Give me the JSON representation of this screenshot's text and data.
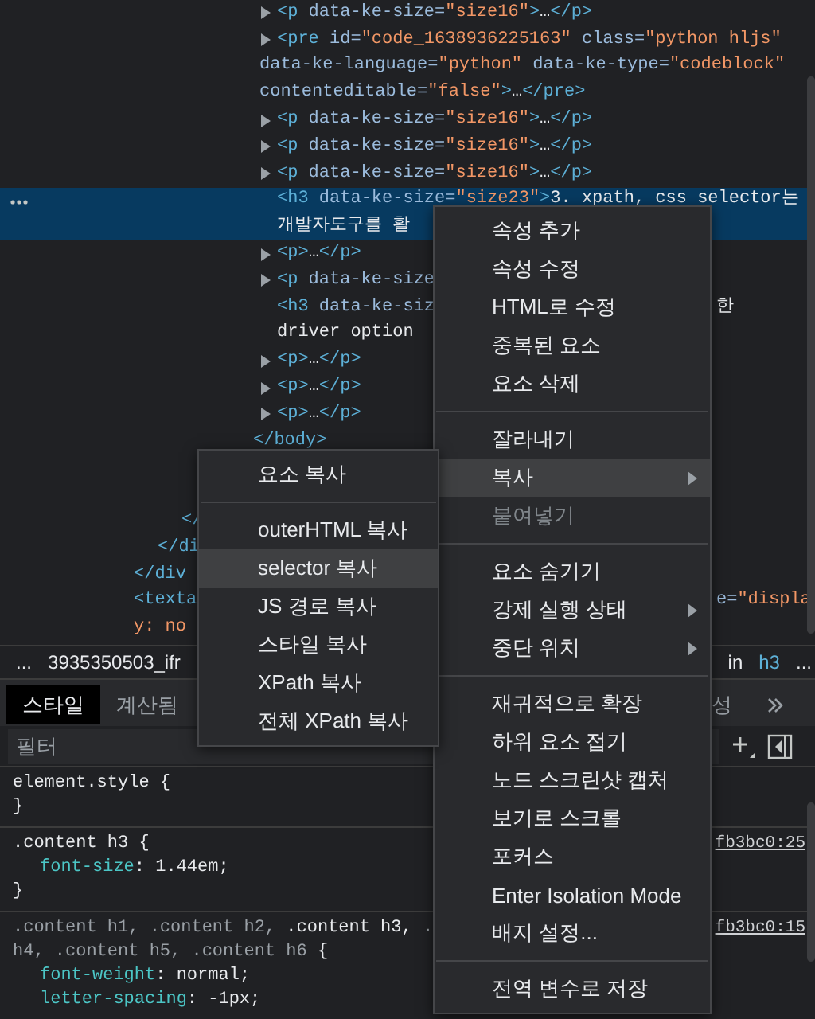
{
  "elements": {
    "nodes": [
      {
        "children": [
          {
            "children": [
              {
                "children": [
                  {
                    "children": [
                      {
                        "children": [
                          {
                            "children": [
                              {
                                "expandable": true,
                                "selected": false,
                                "line": [
                                  {
                                    "kind": "tag",
                                    "text": "<p"
                                  },
                                  {
                                    "kind": "attr",
                                    "text": " data-ke-size="
                                  },
                                  {
                                    "kind": "value",
                                    "text": "\"size16\""
                                  },
                                  {
                                    "kind": "tag",
                                    "text": ">"
                                  },
                                  {
                                    "kind": "text",
                                    "text": "…"
                                  },
                                  {
                                    "kind": "tag",
                                    "text": "</p>"
                                  }
                                ]
                              },
                              {
                                "expandable": true,
                                "selected": false,
                                "line": [
                                  {
                                    "kind": "tag",
                                    "text": "<pre"
                                  },
                                  {
                                    "kind": "attr",
                                    "text": " id="
                                  },
                                  {
                                    "kind": "value",
                                    "text": "\"code_1638936225163\""
                                  },
                                  {
                                    "kind": "attr",
                                    "text": " class="
                                  },
                                  {
                                    "kind": "value",
                                    "text": "\"python hljs\""
                                  }
                                ],
                                "continuation": [
                                  [
                                    {
                                      "kind": "attr",
                                      "text": "data-ke-language="
                                    },
                                    {
                                      "kind": "value",
                                      "text": "\"python\""
                                    },
                                    {
                                      "kind": "attr",
                                      "text": " data-ke-type="
                                    },
                                    {
                                      "kind": "value",
                                      "text": "\"codeblock\""
                                    }
                                  ],
                                  [
                                    {
                                      "kind": "attr",
                                      "text": "contenteditable="
                                    },
                                    {
                                      "kind": "value",
                                      "text": "\"false\""
                                    },
                                    {
                                      "kind": "tag",
                                      "text": ">"
                                    },
                                    {
                                      "kind": "text",
                                      "text": "…"
                                    },
                                    {
                                      "kind": "tag",
                                      "text": "</pre>"
                                    }
                                  ]
                                ]
                              },
                              {
                                "expandable": true,
                                "selected": false,
                                "line": [
                                  {
                                    "kind": "tag",
                                    "text": "<p"
                                  },
                                  {
                                    "kind": "attr",
                                    "text": " data-ke-size="
                                  },
                                  {
                                    "kind": "value",
                                    "text": "\"size16\""
                                  },
                                  {
                                    "kind": "tag",
                                    "text": ">"
                                  },
                                  {
                                    "kind": "text",
                                    "text": "…"
                                  },
                                  {
                                    "kind": "tag",
                                    "text": "</p>"
                                  }
                                ]
                              },
                              {
                                "expandable": true,
                                "selected": false,
                                "line": [
                                  {
                                    "kind": "tag",
                                    "text": "<p"
                                  },
                                  {
                                    "kind": "attr",
                                    "text": " data-ke-size="
                                  },
                                  {
                                    "kind": "value",
                                    "text": "\"size16\""
                                  },
                                  {
                                    "kind": "tag",
                                    "text": ">"
                                  },
                                  {
                                    "kind": "text",
                                    "text": "…"
                                  },
                                  {
                                    "kind": "tag",
                                    "text": "</p>"
                                  }
                                ]
                              },
                              {
                                "expandable": true,
                                "selected": false,
                                "line": [
                                  {
                                    "kind": "tag",
                                    "text": "<p"
                                  },
                                  {
                                    "kind": "attr",
                                    "text": " data-ke-size="
                                  },
                                  {
                                    "kind": "value",
                                    "text": "\"size16\""
                                  },
                                  {
                                    "kind": "tag",
                                    "text": ">"
                                  },
                                  {
                                    "kind": "text",
                                    "text": "…"
                                  },
                                  {
                                    "kind": "tag",
                                    "text": "</p>"
                                  }
                                ]
                              },
                              {
                                "expandable": false,
                                "selected": true,
                                "line": [
                                  {
                                    "kind": "tag",
                                    "text": "<h3"
                                  },
                                  {
                                    "kind": "attr",
                                    "text": " data-ke-size="
                                  },
                                  {
                                    "kind": "value",
                                    "text": "\"size23\""
                                  },
                                  {
                                    "kind": "tag",
                                    "text": ">"
                                  },
                                  {
                                    "kind": "text",
                                    "text": "3. xpath, css selector는"
                                  }
                                ],
                                "continuation": [
                                  [
                                    {
                                      "kind": "text",
                                      "text": "개발자도구를 활"
                                    }
                                  ]
                                ]
                              },
                              {
                                "expandable": true,
                                "selected": false,
                                "line": [
                                  {
                                    "kind": "tag",
                                    "text": "<p>"
                                  },
                                  {
                                    "kind": "text",
                                    "text": "…"
                                  },
                                  {
                                    "kind": "tag",
                                    "text": "</p>"
                                  }
                                ]
                              },
                              {
                                "expandable": true,
                                "selected": false,
                                "line": [
                                  {
                                    "kind": "tag",
                                    "text": "<p"
                                  },
                                  {
                                    "kind": "attr",
                                    "text": " data-ke-size"
                                  }
                                ]
                              },
                              {
                                "expandable": false,
                                "selected": false,
                                "line": [
                                  {
                                    "kind": "tag",
                                    "text": "<h3"
                                  },
                                  {
                                    "kind": "attr",
                                    "text": " data-ke-siz"
                                  }
                                ],
                                "right": [
                                  {
                                    "kind": "text",
                                    "text": "한"
                                  }
                                ],
                                "continuation": [
                                  [
                                    {
                                      "kind": "text",
                                      "text": "driver option"
                                    }
                                  ]
                                ]
                              },
                              {
                                "expandable": true,
                                "selected": false,
                                "line": [
                                  {
                                    "kind": "tag",
                                    "text": "<p>"
                                  },
                                  {
                                    "kind": "text",
                                    "text": "…"
                                  },
                                  {
                                    "kind": "tag",
                                    "text": "</p>"
                                  }
                                ]
                              },
                              {
                                "expandable": true,
                                "selected": false,
                                "line": [
                                  {
                                    "kind": "tag",
                                    "text": "<p>"
                                  },
                                  {
                                    "kind": "text",
                                    "text": "…"
                                  },
                                  {
                                    "kind": "tag",
                                    "text": "</p>"
                                  }
                                ]
                              },
                              {
                                "expandable": true,
                                "selected": false,
                                "line": [
                                  {
                                    "kind": "tag",
                                    "text": "<p>"
                                  },
                                  {
                                    "kind": "text",
                                    "text": "…"
                                  },
                                  {
                                    "kind": "tag",
                                    "text": "</p>"
                                  }
                                ]
                              }
                            ],
                            "closing": [
                              {
                                "kind": "tag",
                                "text": "</body>"
                              }
                            ]
                          }
                        ]
                      }
                    ]
                  }
                ],
                "closing": [
                  {
                    "kind": "tag",
                    "text": "</"
                  }
                ]
              }
            ],
            "closing": [
              {
                "kind": "tag",
                "text": "</di"
              }
            ]
          }
        ],
        "closing": [
          {
            "kind": "tag",
            "text": "</div"
          }
        ]
      },
      {
        "expandable": false,
        "selected": false,
        "line": [
          {
            "kind": "tag",
            "text": "<texta"
          }
        ],
        "right": [
          {
            "kind": "attr",
            "text": "e="
          },
          {
            "kind": "value",
            "text": "\"displa"
          }
        ],
        "continuation": [
          [
            {
              "kind": "value",
              "text": "y: no"
            }
          ]
        ]
      }
    ]
  },
  "breadcrumbs": {
    "left": [
      {
        "kind": "text",
        "text": "..."
      },
      {
        "kind": "text",
        "text": "3935350503_ifr"
      }
    ],
    "right": [
      {
        "kind": "text",
        "text": "in"
      },
      {
        "kind": "tag",
        "text": "h3"
      },
      {
        "kind": "text",
        "text": "..."
      }
    ]
  },
  "styles": {
    "tabs": [
      {
        "label": "스타일",
        "selected": true
      },
      {
        "label": "계산됨",
        "selected": false
      }
    ],
    "overflow_tabs": [
      {
        "label": "성",
        "selected": false
      }
    ],
    "filter": {
      "placeholder": "필터"
    },
    "rules": [
      {
        "lines": [
          [
            {
              "kind": "selector",
              "text": "element.style"
            },
            {
              "kind": "brace",
              "text": " {"
            }
          ]
        ],
        "closing": "}"
      },
      {
        "lines": [
          [
            {
              "kind": "selector",
              "text": ".content h3"
            },
            {
              "kind": "brace",
              "text": " {"
            }
          ]
        ],
        "declarations": [
          [
            {
              "kind": "property",
              "text": "font-size"
            },
            {
              "kind": "plain",
              "text": ": 1.44em;"
            }
          ]
        ],
        "closing": "}",
        "source": "fb3bc0:25"
      },
      {
        "lines": [
          [
            {
              "kind": "dim",
              "text": ".content h1, .content h2, "
            },
            {
              "kind": "selector",
              "text": ".content h3,"
            },
            {
              "kind": "dim",
              "text": " ."
            }
          ],
          [
            {
              "kind": "dim",
              "text": "h4, .content h5, .content h6"
            },
            {
              "kind": "brace",
              "text": " {"
            }
          ]
        ],
        "declarations": [
          [
            {
              "kind": "property",
              "text": "font-weight"
            },
            {
              "kind": "plain",
              "text": ": normal;"
            }
          ],
          [
            {
              "kind": "property",
              "text": "letter-spacing"
            },
            {
              "kind": "plain",
              "text": ": -1px;"
            }
          ]
        ],
        "source": "fb3bc0:15"
      }
    ]
  },
  "context_menu": {
    "items": [
      {
        "kind": "item",
        "label": "속성 추가",
        "selected": false,
        "disabled": false,
        "submenu": false
      },
      {
        "kind": "item",
        "label": "속성 수정",
        "selected": false,
        "disabled": false,
        "submenu": false
      },
      {
        "kind": "item",
        "label": "HTML로 수정",
        "selected": false,
        "disabled": false,
        "submenu": false
      },
      {
        "kind": "item",
        "label": "중복된 요소",
        "selected": false,
        "disabled": false,
        "submenu": false
      },
      {
        "kind": "item",
        "label": "요소 삭제",
        "selected": false,
        "disabled": false,
        "submenu": false
      },
      {
        "kind": "separator"
      },
      {
        "kind": "item",
        "label": "잘라내기",
        "selected": false,
        "disabled": false,
        "submenu": false
      },
      {
        "kind": "item",
        "label": "복사",
        "selected": true,
        "disabled": false,
        "submenu": true
      },
      {
        "kind": "item",
        "label": "붙여넣기",
        "selected": false,
        "disabled": true,
        "submenu": false
      },
      {
        "kind": "separator"
      },
      {
        "kind": "item",
        "label": "요소 숨기기",
        "selected": false,
        "disabled": false,
        "submenu": false
      },
      {
        "kind": "item",
        "label": "강제 실행 상태",
        "selected": false,
        "disabled": false,
        "submenu": true
      },
      {
        "kind": "item",
        "label": "중단 위치",
        "selected": false,
        "disabled": false,
        "submenu": true
      },
      {
        "kind": "separator"
      },
      {
        "kind": "item",
        "label": "재귀적으로 확장",
        "selected": false,
        "disabled": false,
        "submenu": false
      },
      {
        "kind": "item",
        "label": "하위 요소 접기",
        "selected": false,
        "disabled": false,
        "submenu": false
      },
      {
        "kind": "item",
        "label": "노드 스크린샷 캡처",
        "selected": false,
        "disabled": false,
        "submenu": false
      },
      {
        "kind": "item",
        "label": "보기로 스크롤",
        "selected": false,
        "disabled": false,
        "submenu": false
      },
      {
        "kind": "item",
        "label": "포커스",
        "selected": false,
        "disabled": false,
        "submenu": false
      },
      {
        "kind": "item",
        "label": "Enter Isolation Mode",
        "selected": false,
        "disabled": false,
        "submenu": false
      },
      {
        "kind": "item",
        "label": "배지 설정...",
        "selected": false,
        "disabled": false,
        "submenu": false
      },
      {
        "kind": "separator"
      },
      {
        "kind": "item",
        "label": "전역 변수로 저장",
        "selected": false,
        "disabled": false,
        "submenu": false
      }
    ]
  },
  "copy_submenu": {
    "items": [
      {
        "kind": "item",
        "label": "요소 복사",
        "selected": false,
        "disabled": false,
        "submenu": false
      },
      {
        "kind": "separator"
      },
      {
        "kind": "item",
        "label": "outerHTML 복사",
        "selected": false,
        "disabled": false,
        "submenu": false
      },
      {
        "kind": "item",
        "label": "selector 복사",
        "selected": true,
        "disabled": false,
        "submenu": false
      },
      {
        "kind": "item",
        "label": "JS 경로 복사",
        "selected": false,
        "disabled": false,
        "submenu": false
      },
      {
        "kind": "item",
        "label": "스타일 복사",
        "selected": false,
        "disabled": false,
        "submenu": false
      },
      {
        "kind": "item",
        "label": "XPath 복사",
        "selected": false,
        "disabled": false,
        "submenu": false
      },
      {
        "kind": "item",
        "label": "전체 XPath 복사",
        "selected": false,
        "disabled": false,
        "submenu": false
      }
    ]
  }
}
